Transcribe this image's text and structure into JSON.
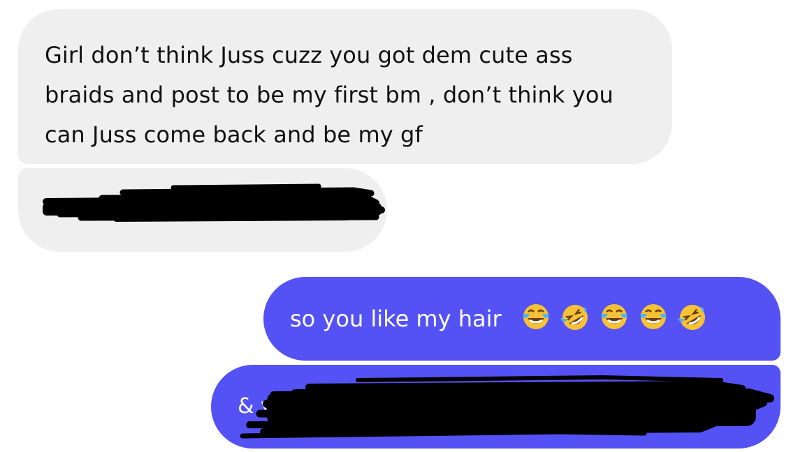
{
  "conversation": {
    "messages": [
      {
        "direction": "incoming",
        "text": "Girl don’t think Juss cuzz you got dem cute ass braids and post to be my first bm , don’t think you can Juss come back and be my gf"
      },
      {
        "direction": "incoming",
        "text": "",
        "redacted": true
      },
      {
        "direction": "outgoing",
        "text": "so you like my hair",
        "emojis": [
          "face-with-tears-of-joy",
          "rolling-on-the-floor-laughing",
          "face-with-tears-of-joy",
          "face-with-tears-of-joy",
          "rolling-on-the-floor-laughing"
        ]
      },
      {
        "direction": "outgoing",
        "text": "& yo",
        "redacted": true
      }
    ]
  },
  "colors": {
    "incoming_bubble": "#efefef",
    "outgoing_bubble": "#5452f5",
    "redaction": "#000000"
  }
}
